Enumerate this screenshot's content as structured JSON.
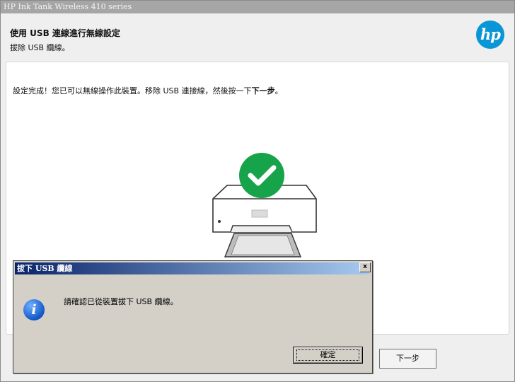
{
  "window": {
    "title": "HP Ink Tank Wireless 410 series"
  },
  "header": {
    "title": "使用 USB 連線進行無線設定",
    "subtitle": "拔除 USB 纜線。",
    "logo_text": "hp"
  },
  "content": {
    "message_prefix": "設定完成！您已可以無線操作此裝置。移除 USB 連接線，然後按一下",
    "message_bold": "下一步",
    "message_suffix": "。"
  },
  "footer": {
    "next_label": "下一步"
  },
  "dialog": {
    "title": "拔下 USB 纜線",
    "close_label": "x",
    "message": "請確認已從裝置拔下 USB 纜線。",
    "info_glyph": "i",
    "ok_label": "確定"
  },
  "colors": {
    "brand": "#0a96d6",
    "success": "#17a34a",
    "dialog_title": "#0a246a"
  }
}
